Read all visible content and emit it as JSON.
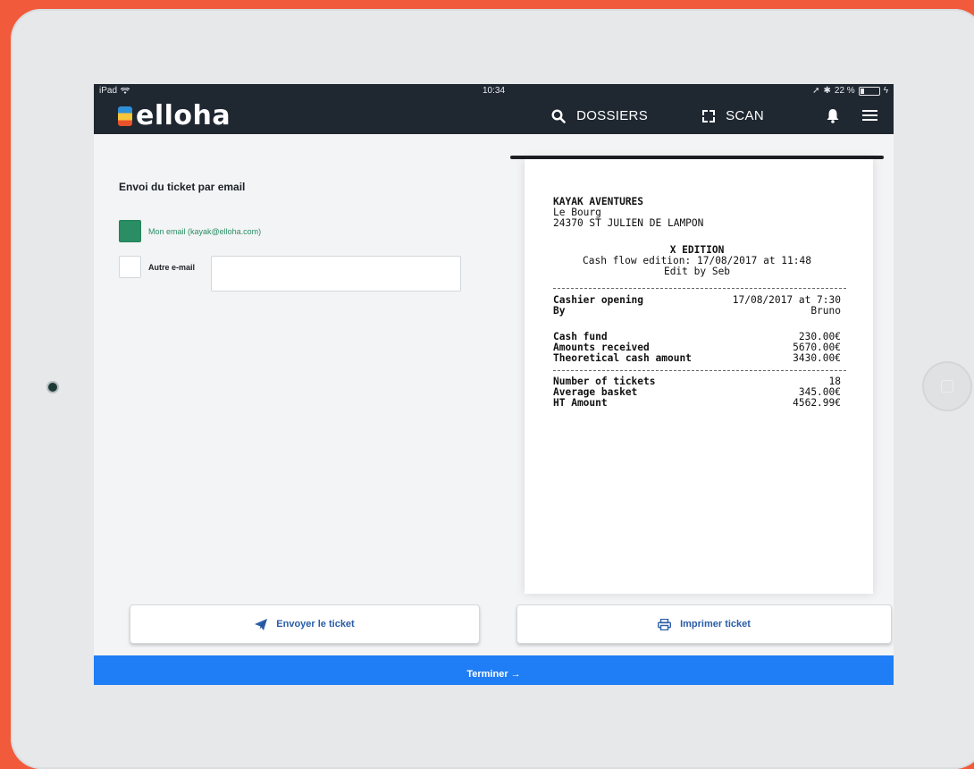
{
  "status_bar": {
    "device": "iPad",
    "time": "10:34",
    "battery": "22 %",
    "battery_level": 0.22
  },
  "header": {
    "logo_text": "elloha",
    "dossiers_label": "DOSSIERS",
    "scan_label": "SCAN",
    "icons": [
      "search-icon",
      "scan-icon",
      "bell-icon",
      "menu-icon"
    ]
  },
  "email_form": {
    "title": "Envoi du ticket par email",
    "my_email_label": "Mon email (kayak@elloha.com)",
    "my_email_checked": true,
    "other_email_label": "Autre e-mail",
    "other_email_checked": false,
    "other_email_value": "",
    "other_email_placeholder": ""
  },
  "receipt": {
    "shop_name": "KAYAK AVENTURES",
    "address_line1": "Le Bourg",
    "address_line2": "24370 ST JULIEN DE LAMPON",
    "edition_title": "X EDITION",
    "edition_line": "Cash flow edition: 17/08/2017 at 11:48",
    "edited_by": "Edit by Seb",
    "opening": [
      {
        "label": "Cashier opening",
        "value": "17/08/2017 at 7:30"
      },
      {
        "label": "By",
        "value": "Bruno"
      }
    ],
    "amounts": [
      {
        "label": "Cash fund",
        "value": "230.00€"
      },
      {
        "label": "Amounts received",
        "value": "5670.00€"
      },
      {
        "label": "Theoretical cash amount",
        "value": "3430.00€"
      }
    ],
    "stats": [
      {
        "label": "Number of tickets",
        "value": "18"
      },
      {
        "label": "Average basket",
        "value": "345.00€"
      },
      {
        "label": "HT Amount",
        "value": "4562.99€"
      }
    ]
  },
  "actions": {
    "send_label": "Envoyer le ticket",
    "print_label": "Imprimer ticket",
    "finish_label": "Terminer →"
  },
  "colors": {
    "accent_blue": "#1f7df5",
    "checked_green": "#2a8d63",
    "header_dark": "#1f2731",
    "background_orange": "#f15a3a"
  }
}
